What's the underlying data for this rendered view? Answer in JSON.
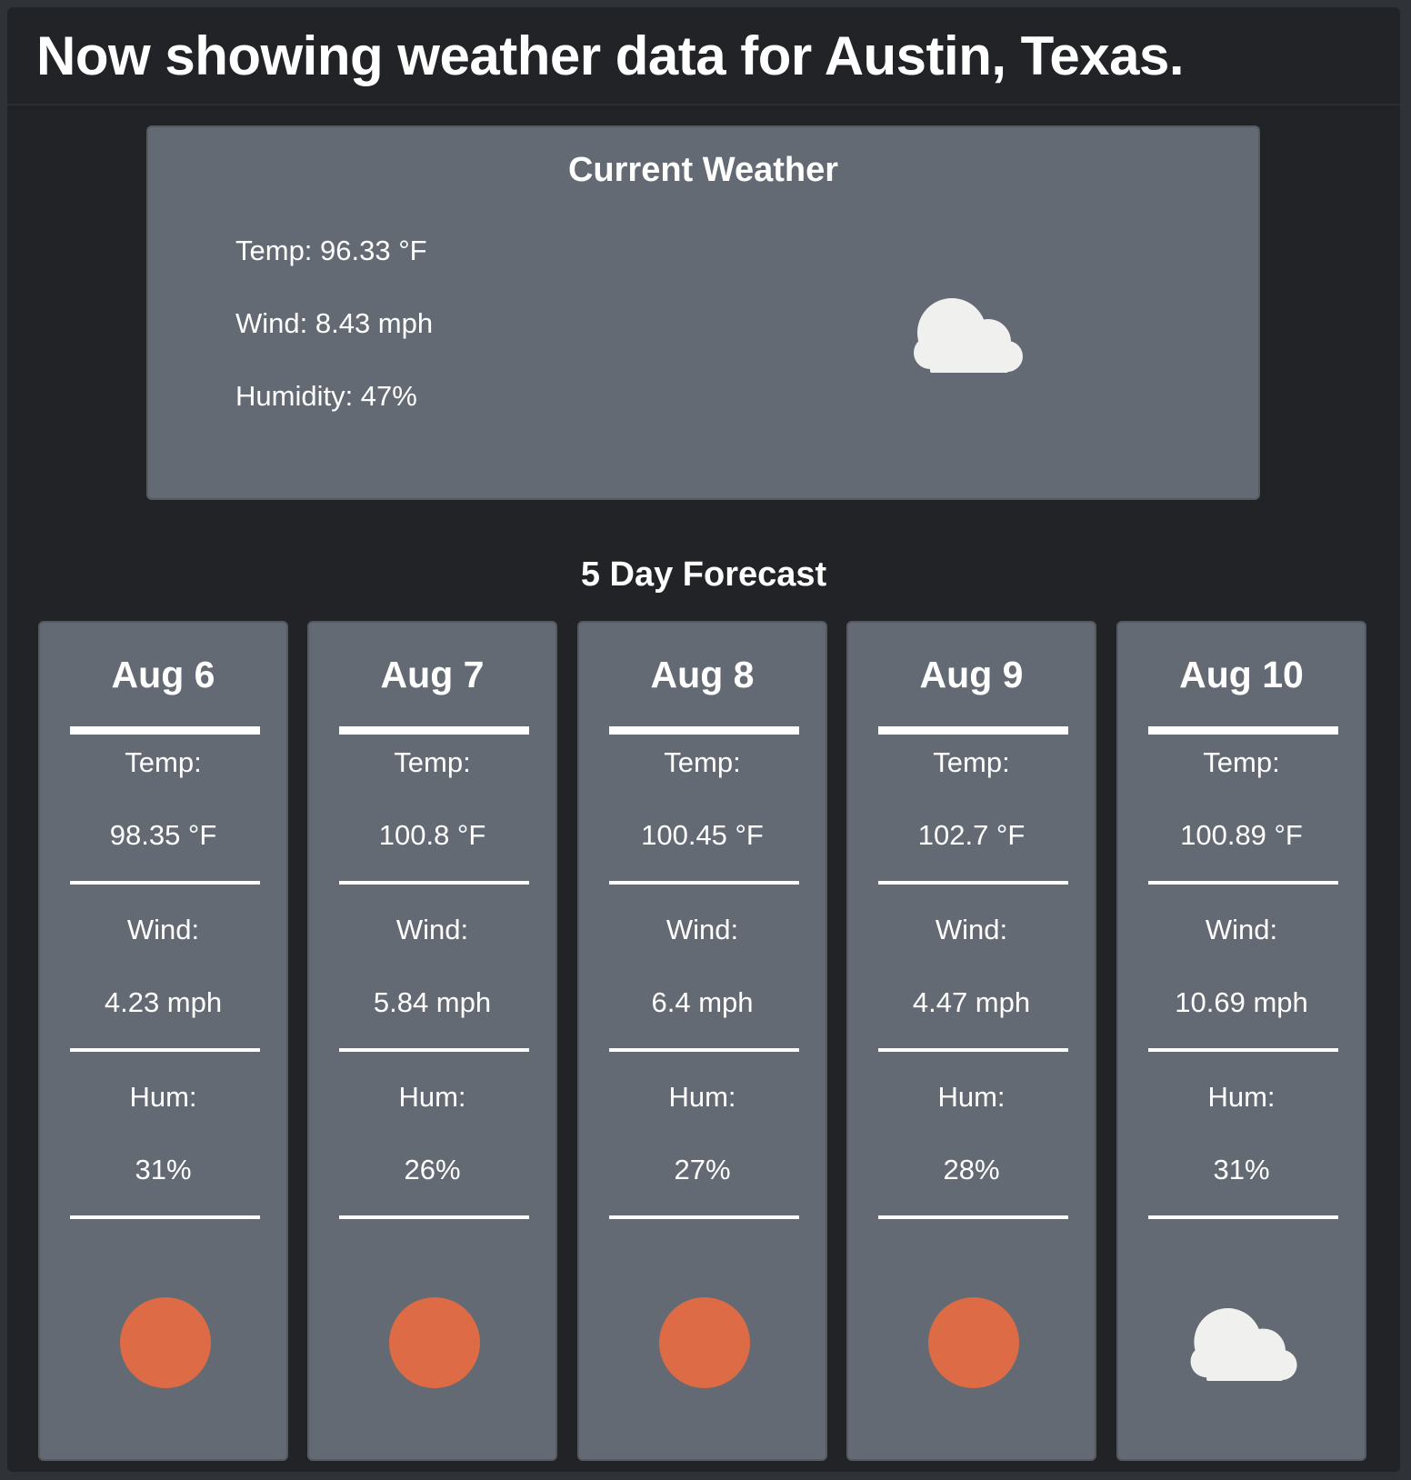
{
  "header": {
    "title": "Now showing weather data for Austin, Texas."
  },
  "current": {
    "title": "Current Weather",
    "temp": "Temp: 96.33 °F",
    "wind": "Wind: 8.43 mph",
    "humidity": "Humidity: 47%",
    "icon": "cloud-icon"
  },
  "forecast": {
    "title": "5 Day Forecast",
    "labels": {
      "temp": "Temp:",
      "wind": "Wind:",
      "hum": "Hum:"
    },
    "days": [
      {
        "date": "Aug 6",
        "temp": "98.35 °F",
        "wind": "4.23 mph",
        "hum": "31%",
        "icon": "sun-icon"
      },
      {
        "date": "Aug 7",
        "temp": "100.8 °F",
        "wind": "5.84 mph",
        "hum": "26%",
        "icon": "sun-icon"
      },
      {
        "date": "Aug 8",
        "temp": "100.45 °F",
        "wind": "6.4 mph",
        "hum": "27%",
        "icon": "sun-icon"
      },
      {
        "date": "Aug 9",
        "temp": "102.7 °F",
        "wind": "4.47 mph",
        "hum": "28%",
        "icon": "sun-icon"
      },
      {
        "date": "Aug 10",
        "temp": "100.89 °F",
        "wind": "10.69 mph",
        "hum": "31%",
        "icon": "cloud-icon"
      }
    ]
  },
  "colors": {
    "background": "#212327",
    "card": "#646a73",
    "sun": "#dc6b46",
    "cloud": "#f0f0ee"
  }
}
